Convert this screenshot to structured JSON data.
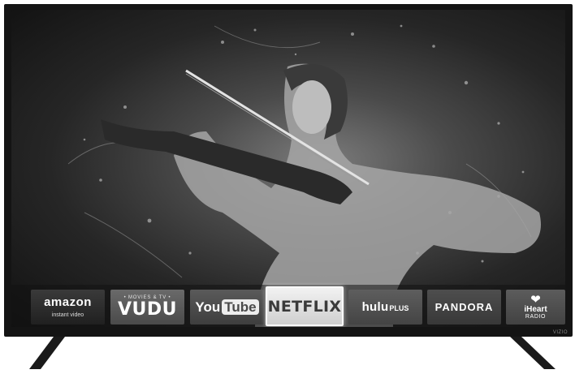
{
  "tv": {
    "brand": "VIZIO"
  },
  "apps": [
    {
      "id": "amazon",
      "label": "amazon",
      "sublabel": "instant video"
    },
    {
      "id": "vudu",
      "label": "VUDU",
      "sublabel": "• MOVIES & TV •"
    },
    {
      "id": "youtube",
      "label_you": "You",
      "label_tube": "Tube"
    },
    {
      "id": "netflix",
      "label": "NETFLIX",
      "selected": true
    },
    {
      "id": "hulu",
      "label": "hulu",
      "sublabel": "PLUS"
    },
    {
      "id": "pandora",
      "label": "PANDORA"
    },
    {
      "id": "iheart",
      "label": "iHeart",
      "sublabel": "RADIO"
    }
  ],
  "colors": {
    "bezel": "#141414",
    "focus": "#ffffff"
  }
}
